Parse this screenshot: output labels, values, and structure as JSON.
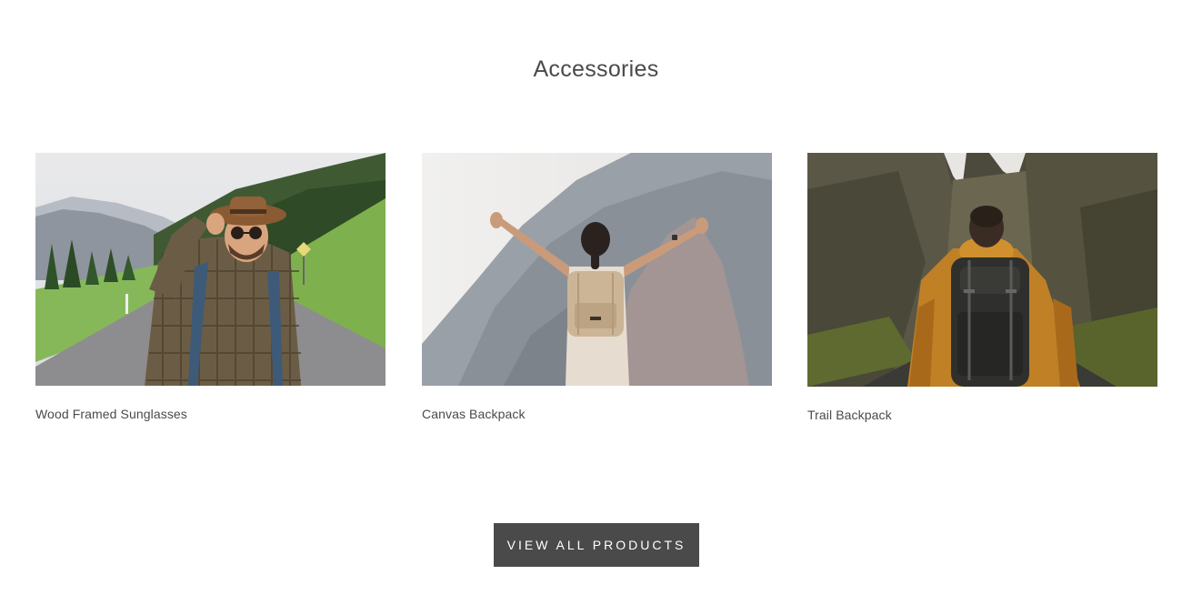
{
  "section": {
    "title": "Accessories"
  },
  "products": [
    {
      "name": "Wood Framed Sunglasses",
      "image": "man-with-hat-and-sunglasses-on-mountain-road"
    },
    {
      "name": "Canvas Backpack",
      "image": "woman-with-backpack-arms-raised-facing-cliff"
    },
    {
      "name": "Trail Backpack",
      "image": "man-in-yellow-jacket-with-backpack-in-canyon"
    }
  ],
  "cta": {
    "label": "VIEW ALL PRODUCTS"
  },
  "colors": {
    "button_bg": "#4a4a4a",
    "button_text": "#ffffff",
    "text": "#4a4a4a",
    "background": "#ffffff"
  }
}
